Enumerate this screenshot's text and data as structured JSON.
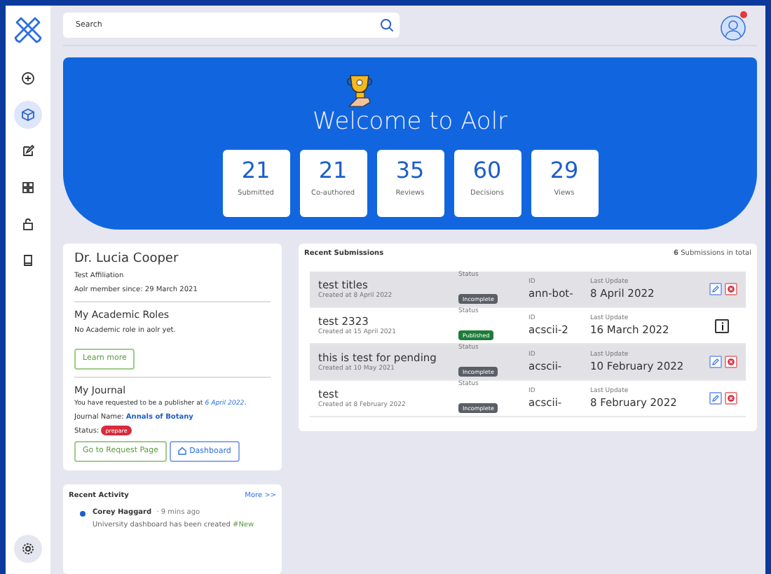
{
  "sidebar": {
    "items": [
      {
        "selected": false
      },
      {
        "selected": true
      },
      {
        "selected": false
      },
      {
        "selected": false
      },
      {
        "selected": false
      },
      {
        "selected": false
      }
    ]
  },
  "header": {
    "search": {
      "placeholder": "Search"
    },
    "avatar": {
      "notification": true
    }
  },
  "banner": {
    "title": "Welcome to Aolr",
    "stats": [
      {
        "value": "21",
        "label": "Submitted"
      },
      {
        "value": "21",
        "label": "Co-authored"
      },
      {
        "value": "35",
        "label": "Reviews"
      },
      {
        "value": "60",
        "label": "Decisions"
      },
      {
        "value": "29",
        "label": "Views"
      }
    ]
  },
  "profile": {
    "name": "Dr. Lucia Cooper",
    "affiliation": "Test Affiliation",
    "member_since": "Aolr member since: 29 March 2021",
    "roles": {
      "title": "My Academic Roles",
      "text": "No Academic role in aolr yet.",
      "button": "Learn more"
    },
    "journal": {
      "title": "My Journal",
      "request": "You have requested to be a publisher at *6 April 2022*.",
      "journal_label": "Journal Name:",
      "journal_name": "Annals of Botany",
      "status_label": "Status:",
      "status": "prepare",
      "buttons": [
        "Go to Request Page",
        "Dashboard"
      ]
    }
  },
  "recent_activity": {
    "title": "Recent Activity",
    "more": "More >>",
    "items": [
      {
        "user": "Corey Haggard",
        "time": "· 9 mins ago",
        "text": "University dashboard has been created",
        "tag": "#New"
      }
    ]
  },
  "recent_submissions": {
    "title": "Recent Submissions",
    "total": "**6** Submissions in total",
    "rows": [
      {
        "title": "test titles",
        "created": "Created at 8 April 2022",
        "status_label": "Status",
        "status": "Incomplete",
        "color": "#5a5f66",
        "id_label": "ID",
        "id": "ann-bot-",
        "update_label": "Last Update",
        "updated": "8 April 2022",
        "shaded": true,
        "kind": "editable"
      },
      {
        "title": "test 2323",
        "created": "Created at 15 April 2021",
        "status_label": "Status",
        "status": "Published",
        "color": "#1e7b3a",
        "id_label": "ID",
        "id": "acscii-2",
        "update_label": "Last Update",
        "updated": "16 March 2022",
        "shaded": false,
        "kind": "info"
      },
      {
        "title": "this is test for pending",
        "created": "Created at 10 May 2021",
        "status_label": "Status",
        "status": "Incomplete",
        "color": "#5a5f66",
        "id_label": "ID",
        "id": "acscii-",
        "update_label": "Last Update",
        "updated": "10 February 2022",
        "shaded": true,
        "kind": "editable"
      },
      {
        "title": "test",
        "created": "Created at 8 February 2022",
        "status_label": "Status",
        "status": "Incomplete",
        "color": "#5a5f66",
        "id_label": "ID",
        "id": "acscii-",
        "update_label": "Last Update",
        "updated": "8 February 2022",
        "shaded": false,
        "kind": "editable"
      }
    ]
  }
}
